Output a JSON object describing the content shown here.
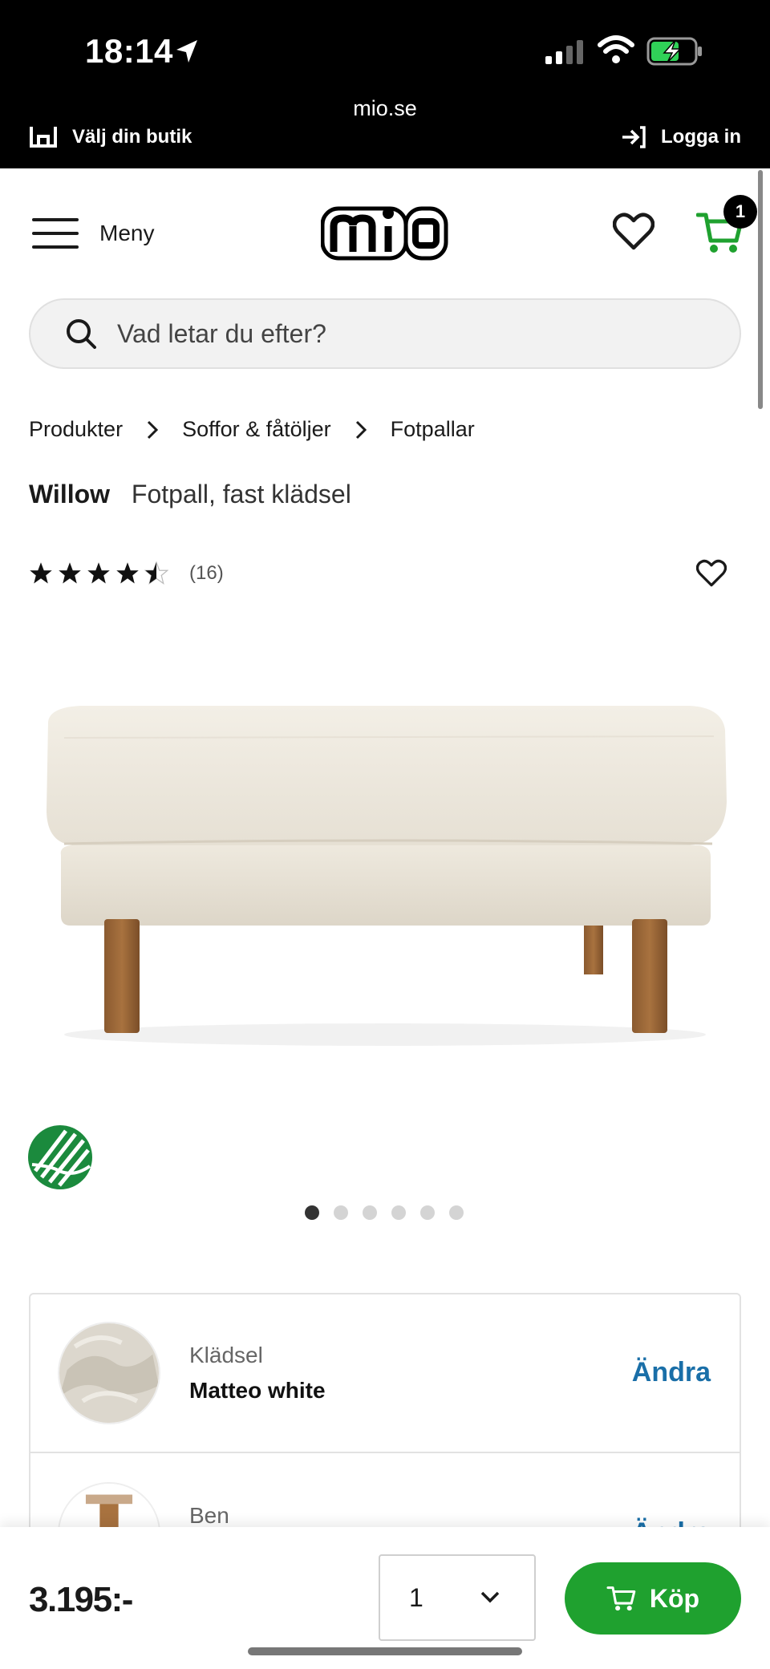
{
  "status_bar": {
    "time": "18:14",
    "url": "mio.se"
  },
  "top_strip": {
    "store_label": "Välj din butik",
    "login_label": "Logga in"
  },
  "header": {
    "menu_label": "Meny",
    "logo_alt": "mio",
    "cart_count": "1"
  },
  "search": {
    "placeholder": "Vad letar du efter?"
  },
  "breadcrumb": [
    "Produkter",
    "Soffor & fåtöljer",
    "Fotpallar"
  ],
  "product": {
    "brand": "Willow",
    "description": "Fotpall, fast klädsel",
    "rating": 4.5,
    "review_count": "(16)",
    "image_count": 6,
    "active_image": 1
  },
  "config": [
    {
      "label": "Klädsel",
      "value": "Matteo white",
      "action": "Ändra"
    },
    {
      "label": "Ben",
      "value": "",
      "action": "Ändra"
    }
  ],
  "buy_bar": {
    "price": "3.195:-",
    "quantity": "1",
    "buy_label": "Köp"
  },
  "colors": {
    "accent_green": "#1fa12f",
    "link_blue": "#1a6fa8",
    "cart_green": "#1fa12f"
  },
  "icons": [
    "location-arrow-icon",
    "signal-icon",
    "wifi-icon",
    "battery-charging-icon",
    "store-icon",
    "login-icon",
    "hamburger-icon",
    "heart-icon",
    "cart-icon",
    "search-icon",
    "chevron-right-icon",
    "star-icon",
    "swan-ecolabel-icon",
    "chevron-down-icon"
  ]
}
